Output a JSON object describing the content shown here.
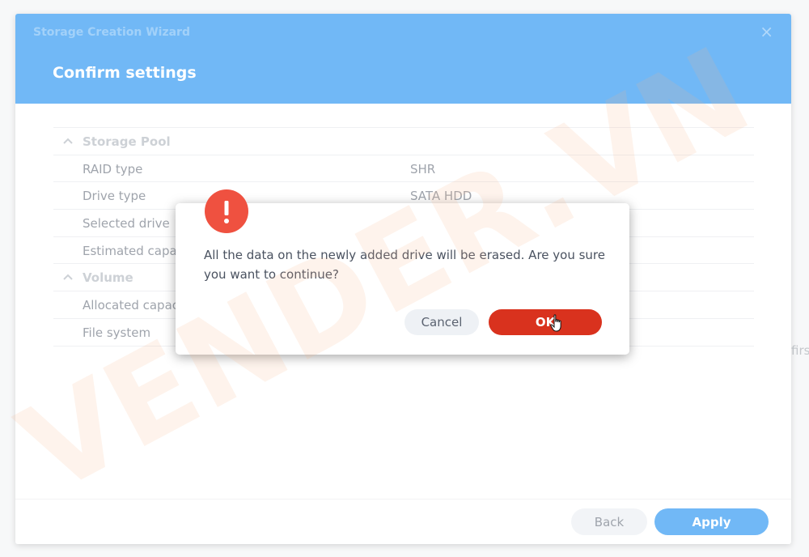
{
  "background": {
    "partial_text": "firs"
  },
  "window": {
    "title": "Storage Creation Wizard",
    "close_glyph": "×",
    "heading": "Confirm settings"
  },
  "summary": {
    "storage_pool": {
      "section_label": "Storage Pool",
      "rows": [
        {
          "label": "RAID type",
          "value": "SHR"
        },
        {
          "label": "Drive type",
          "value": "SATA HDD"
        },
        {
          "label": "Selected drive",
          "value": ""
        },
        {
          "label": "Estimated capa",
          "value": ""
        }
      ]
    },
    "volume": {
      "section_label": "Volume",
      "rows": [
        {
          "label": "Allocated capac",
          "value": ""
        },
        {
          "label": "File system",
          "value": ""
        }
      ]
    }
  },
  "footer": {
    "back_label": "Back",
    "apply_label": "Apply"
  },
  "dialog": {
    "icon": "exclamation-icon",
    "icon_glyph": "!",
    "message": "All the data on the newly added drive will be erased. Are you sure you want to continue?",
    "cancel_label": "Cancel",
    "ok_label": "OK"
  },
  "watermark": {
    "text": "VENDER.VN"
  },
  "colors": {
    "header_blue": "#0b86f0",
    "ok_red": "#d9321e",
    "icon_red": "#ef5140",
    "watermark": "#f6b28a"
  }
}
